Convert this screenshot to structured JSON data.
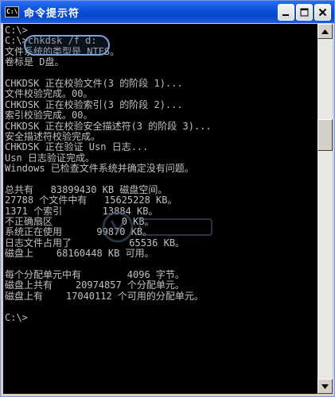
{
  "window": {
    "title": "命令提示符",
    "icon_text": "C:\\"
  },
  "console": {
    "lines": [
      "C:\\>",
      "C:\\>chkdsk /f d:",
      "文件系统的类型是 NTFS。",
      "卷标是 D盘。",
      "",
      "CHKDSK 正在校验文件(3 的阶段 1)...",
      "文件校验完成。00。",
      "CHKDSK 正在校验索引(3 的阶段 2)...",
      "索引校验完成。00。",
      "CHKDSK 正在校验安全描述符(3 的阶段 3)...",
      "安全描述符校验完成。",
      "CHKDSK 正在验证 Usn 日志...",
      "Usn 日志验证完成。",
      "Windows 已检查文件系统并确定没有问题。",
      "",
      "总共有   83899430 KB 磁盘空间。",
      "27788 个文件中有   15625228 KB。",
      "1371 个索引       13884 KB。",
      "不正确扇区            0 KB。",
      "系统正在使用      99870 KB。",
      "日志文件占用了          65536 KB。",
      "磁盘上    68160448 KB 可用。",
      "",
      "每个分配单元中有        4096 字节。",
      "磁盘上共有    20974857 个分配单元。",
      "磁盘上有    17040112 个可用的分配单元。",
      "",
      "C:\\>"
    ]
  },
  "colors": {
    "console_bg": "#000000",
    "console_text": "#c0c0c0",
    "titlebar": "#0b4fd8"
  },
  "icons": {
    "minimize": "minimize-icon",
    "maximize": "maximize-icon",
    "close": "close-icon",
    "scroll_up": "arrow-up-icon",
    "scroll_down": "arrow-down-icon"
  }
}
